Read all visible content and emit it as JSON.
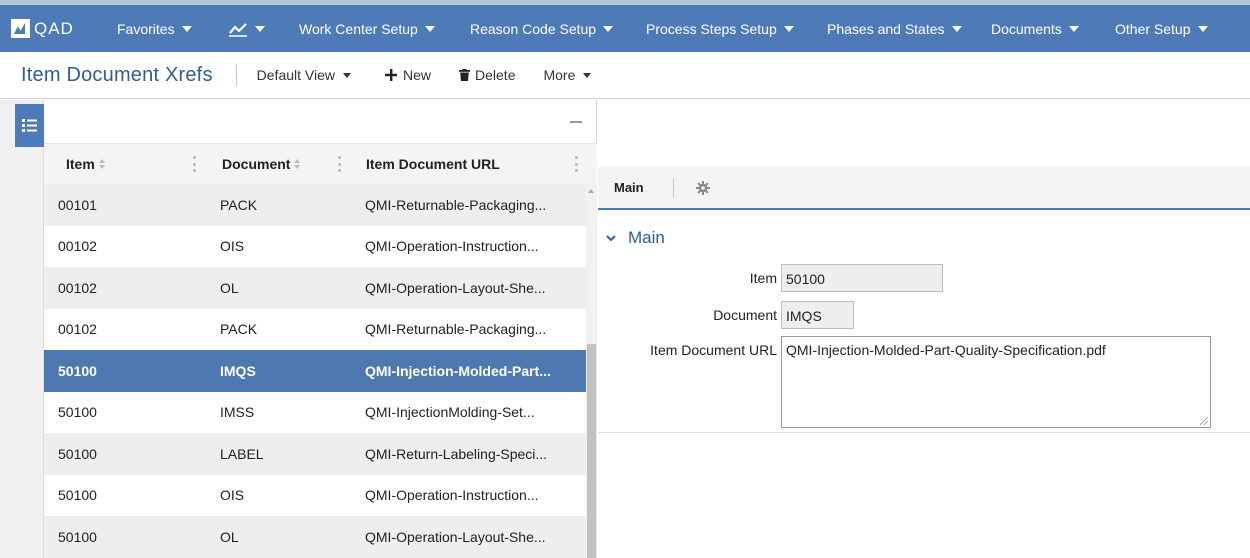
{
  "nav": {
    "logo_text": "QAD",
    "items": [
      {
        "label": "Favorites",
        "icon": ""
      },
      {
        "label": "",
        "icon": "chart-line-icon"
      },
      {
        "label": "Work Center Setup"
      },
      {
        "label": "Reason Code Setup"
      },
      {
        "label": "Process Steps Setup"
      },
      {
        "label": "Phases and States"
      },
      {
        "label": "Documents"
      },
      {
        "label": "Other Setup"
      }
    ],
    "color": "#4e7ab8"
  },
  "toolbar": {
    "title": "Item Document Xrefs",
    "view_label": "Default View",
    "new_label": "New",
    "delete_label": "Delete",
    "more_label": "More"
  },
  "grid": {
    "columns": [
      "Item",
      "Document",
      "Item Document URL"
    ],
    "rows": [
      {
        "item": "00101",
        "document": "PACK",
        "url": "QMI-Returnable-Packaging..."
      },
      {
        "item": "00102",
        "document": "OIS",
        "url": "QMI-Operation-Instruction..."
      },
      {
        "item": "00102",
        "document": "OL",
        "url": "QMI-Operation-Layout-She..."
      },
      {
        "item": "00102",
        "document": "PACK",
        "url": "QMI-Returnable-Packaging..."
      },
      {
        "item": "50100",
        "document": "IMQS",
        "url": "QMI-Injection-Molded-Part..."
      },
      {
        "item": "50100",
        "document": "IMSS",
        "url": "QMI-InjectionMolding-Set..."
      },
      {
        "item": "50100",
        "document": "LABEL",
        "url": "QMI-Return-Labeling-Speci..."
      },
      {
        "item": "50100",
        "document": "OIS",
        "url": "QMI-Operation-Instruction..."
      },
      {
        "item": "50100",
        "document": "OL",
        "url": "QMI-Operation-Layout-She..."
      }
    ],
    "selected_index": 4
  },
  "detail": {
    "tab_main": "Main",
    "section_title": "Main",
    "item_label": "Item",
    "item_value": "50100",
    "document_label": "Document",
    "document_value": "IMQS",
    "url_label": "Item Document URL",
    "url_value": "QMI-Injection-Molded-Part-Quality-Specification.pdf"
  }
}
